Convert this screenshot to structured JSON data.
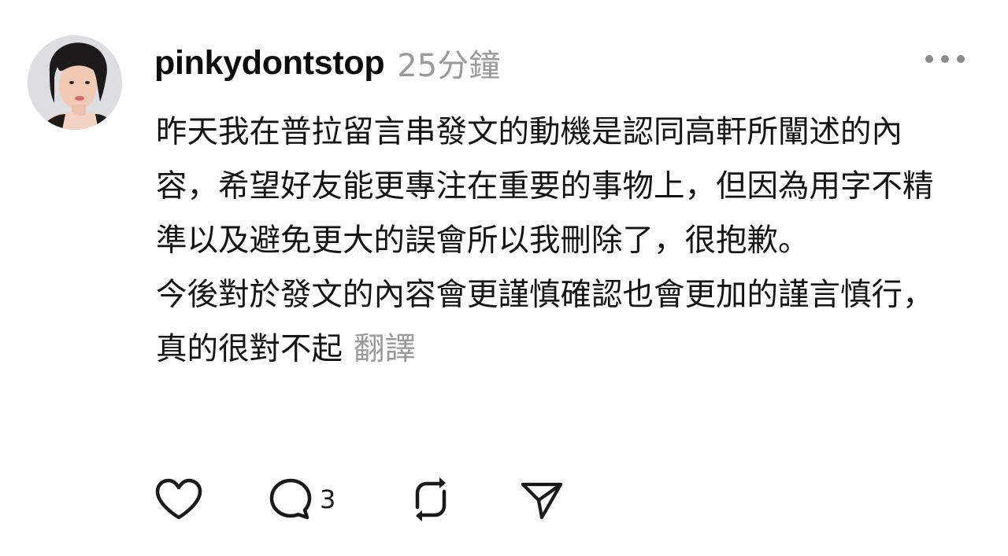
{
  "post": {
    "author": {
      "username": "pinkydontstop"
    },
    "timestamp": "25分鐘",
    "paragraphs": [
      "昨天我在普拉留言串發文的動機是認同高軒所闡述的內容，希望好友能更專注在重要的事物上，但因為用字不精準以及避免更大的誤會所以我刪除了，很抱歉。",
      "今後對於發文的內容會更謹慎確認也會更加的謹言慎行，真的很對不起"
    ],
    "translate_label": "翻譯",
    "actions": {
      "like_icon": "heart-icon",
      "reply_icon": "comment-bubble-icon",
      "reply_count": "3",
      "repost_icon": "repost-icon",
      "share_icon": "send-icon"
    }
  },
  "colors": {
    "text_primary": "#111111",
    "text_secondary": "#9a9a9a",
    "background": "#ffffff"
  }
}
